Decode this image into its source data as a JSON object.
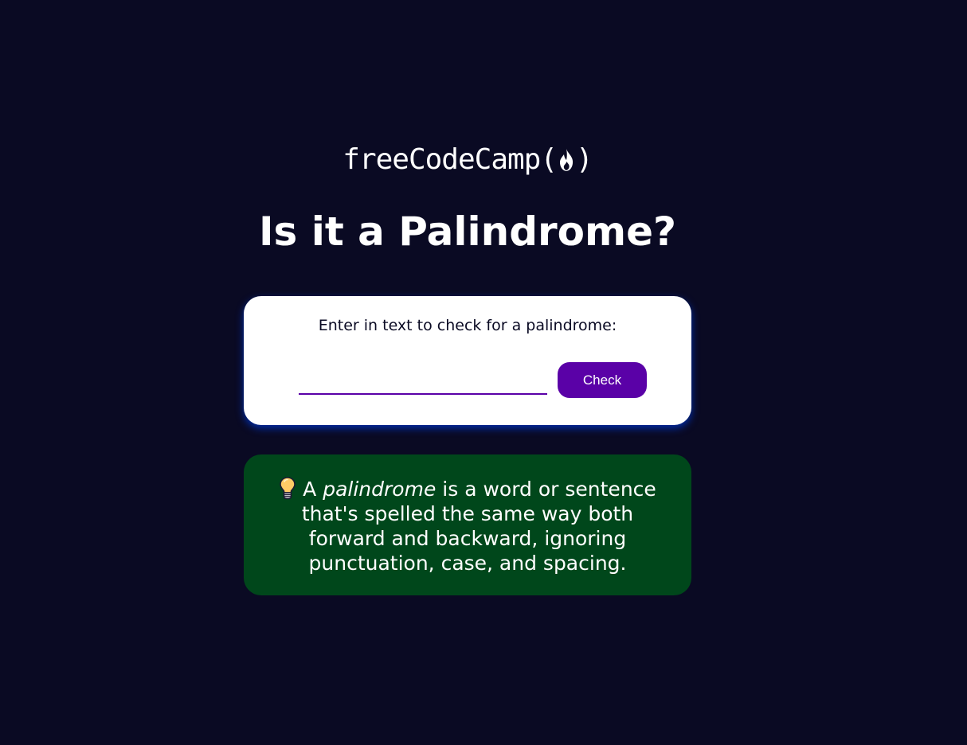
{
  "logo": {
    "text": "freeCodeCamp(",
    "close": ")",
    "icon": "flame-icon"
  },
  "title": "Is it a Palindrome?",
  "checker": {
    "label": "Enter in text to check for a palindrome:",
    "input_value": "",
    "button_label": "Check"
  },
  "info": {
    "icon": "lightbulb-icon",
    "prefix": "A",
    "emphasis": "palindrome",
    "rest": "is a word or sentence that's spelled the same way both forward and backward, ignoring punctuation, case, and spacing."
  },
  "colors": {
    "background": "#0a0a23",
    "card": "#ffffff",
    "accent": "#5a01a7",
    "info_bg": "#00471b",
    "card_shadow": "#002ead"
  }
}
